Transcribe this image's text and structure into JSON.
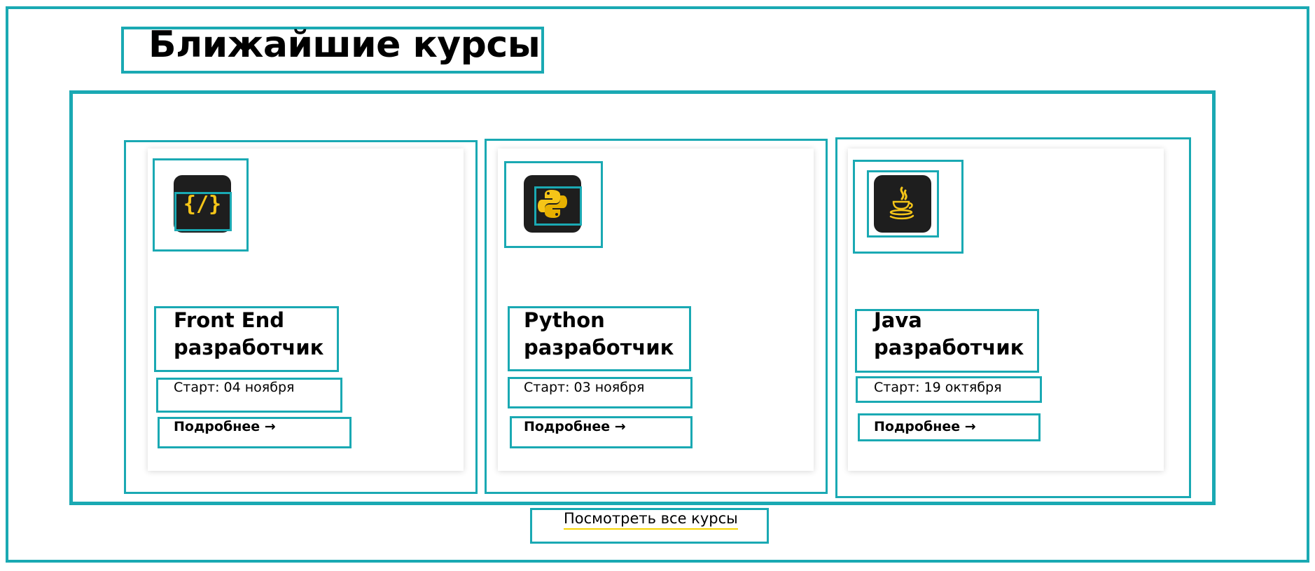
{
  "section": {
    "title": "Ближайшие курсы"
  },
  "courses": [
    {
      "title_line1": "Front End",
      "title_line2": "разработчик",
      "start": "Старт: 04 ноября",
      "link": "Подробнее →",
      "icon": "code-braces-icon",
      "icon_text": "{/}"
    },
    {
      "title_line1": "Python",
      "title_line2": "разработчик",
      "start": "Старт: 03 ноября",
      "link": "Подробнее →",
      "icon": "python-logo-icon"
    },
    {
      "title_line1": "Java",
      "title_line2": "разработчик",
      "start": "Старт: 19 октября",
      "link": "Подробнее →",
      "icon": "java-coffee-cup-icon"
    }
  ],
  "all_courses_link": "Посмотреть все курсы",
  "colors": {
    "frame": "#1aa9b3",
    "icon_bg": "#1e1e1e",
    "icon_accent": "#f5c518",
    "link_underline": "#f5d400"
  }
}
